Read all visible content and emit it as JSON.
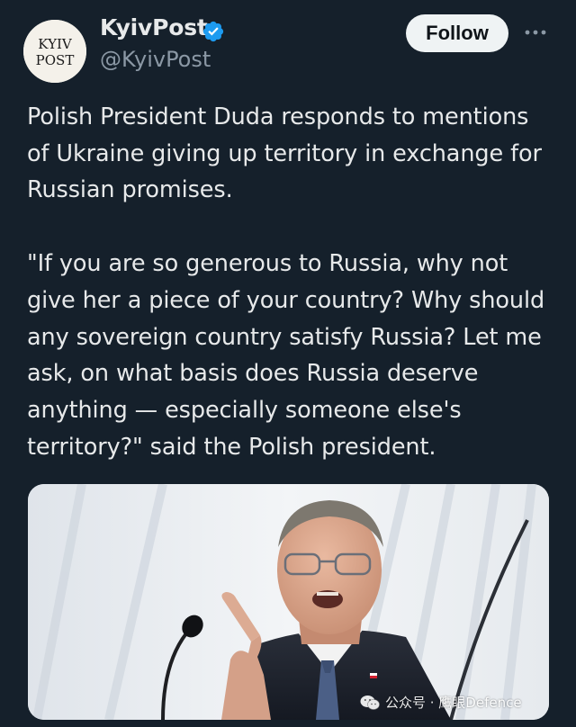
{
  "account": {
    "display_name": "KyivPost",
    "handle": "@KyivPost",
    "logo_line1": "KYIV",
    "logo_line2": "POST",
    "verified_color": "#1d9bf0"
  },
  "actions": {
    "follow_label": "Follow",
    "more_icon": "more-horizontal-icon"
  },
  "tweet": {
    "paragraph1": "Polish President Duda responds to mentions\nof Ukraine giving up territory in exchange for\nRussian promises.",
    "paragraph2": "\"If you are so generous to Russia, why not\ngive her a piece of your country? Why should\nany sovereign country satisfy Russia? Let me\nask, on what basis does Russia deserve\nanything — especially someone else's\nterritory?\" said the Polish president."
  },
  "watermark": {
    "text": "公众号 · 鹰眼Defence"
  },
  "colors": {
    "background": "#15202b",
    "text_primary": "#e7e9ea",
    "text_secondary": "#8b98a5",
    "button_bg": "#eff3f4"
  }
}
